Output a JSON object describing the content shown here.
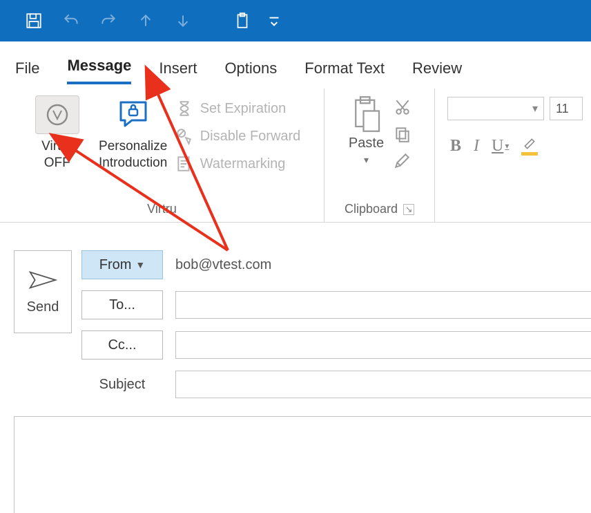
{
  "menu": {
    "tabs": [
      "File",
      "Message",
      "Insert",
      "Options",
      "Format Text",
      "Review"
    ],
    "active_index": 1
  },
  "ribbon": {
    "virtru": {
      "toggle": {
        "line1": "Virtru",
        "line2": "OFF"
      },
      "personalize": {
        "line1": "Personalize",
        "line2": "Introduction"
      },
      "options": {
        "expiration": "Set Expiration",
        "disable_forward": "Disable Forward",
        "watermarking": "Watermarking"
      },
      "group_label": "Virtru"
    },
    "clipboard": {
      "paste_label": "Paste",
      "group_label": "Clipboard"
    },
    "font": {
      "size": "11",
      "bold": "B",
      "italic": "I",
      "underline": "U"
    }
  },
  "compose": {
    "send_label": "Send",
    "from_label": "From",
    "from_value": "bob@vtest.com",
    "to_label": "To...",
    "cc_label": "Cc...",
    "subject_label": "Subject"
  }
}
